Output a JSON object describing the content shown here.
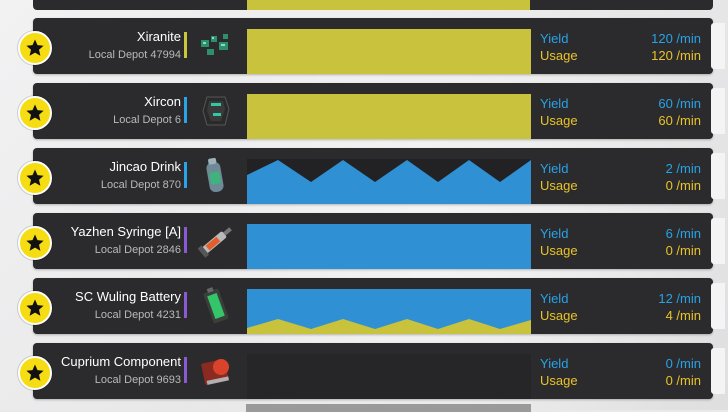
{
  "colors": {
    "yield": "#27a3e6",
    "usage": "#e9c327",
    "usage_fill": "#c9c23c",
    "yield_fill": "#2f90d4",
    "card_bg": "#2b2b2d",
    "badge": "#f6dc12"
  },
  "labels": {
    "yield": "Yield",
    "usage": "Usage"
  },
  "items": [
    {
      "name": "Xiranite",
      "depot": "Local Depot 47994",
      "accent": "#c8c83a",
      "icon": "xiranite-icon",
      "yield": "120 /min",
      "usage": "120 /min",
      "chart": "usage-full"
    },
    {
      "name": "Xircon",
      "depot": "Local Depot 6",
      "accent": "#2aa4e8",
      "icon": "xircon-icon",
      "yield": "60 /min",
      "usage": "60 /min",
      "chart": "usage-full"
    },
    {
      "name": "Jincao Drink",
      "depot": "Local Depot 870",
      "accent": "#2aa4e8",
      "icon": "jincao-drink-icon",
      "yield": "2 /min",
      "usage": "0 /min",
      "chart": "yield-zigzag"
    },
    {
      "name": "Yazhen Syringe [A]",
      "depot": "Local Depot 2846",
      "accent": "#8a5ad6",
      "icon": "yazhen-syringe-icon",
      "yield": "6 /min",
      "usage": "0 /min",
      "chart": "yield-full"
    },
    {
      "name": "SC Wuling Battery",
      "depot": "Local Depot 4231",
      "accent": "#8a5ad6",
      "icon": "sc-wuling-battery-icon",
      "yield": "12 /min",
      "usage": "4 /min",
      "chart": "yield-over-usage"
    },
    {
      "name": "Cuprium Component",
      "depot": "Local Depot 9693",
      "accent": "#8a5ad6",
      "icon": "cuprium-component-icon",
      "yield": "0 /min",
      "usage": "0 /min",
      "chart": "empty"
    }
  ]
}
